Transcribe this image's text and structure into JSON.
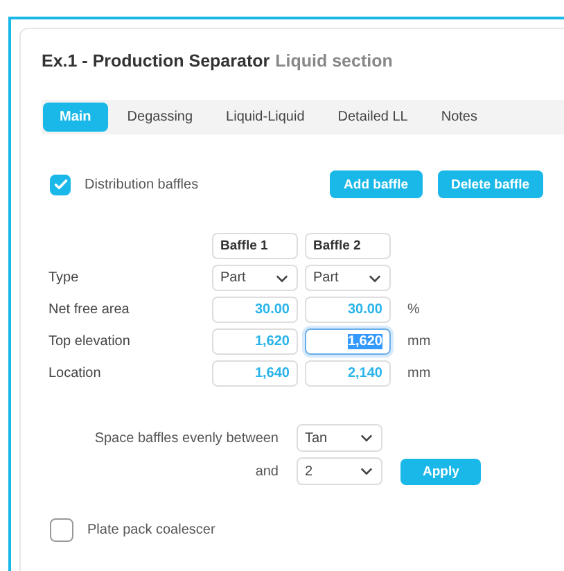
{
  "title": {
    "name": "Ex.1 - Production Separator",
    "section": "Liquid section"
  },
  "tabs": [
    {
      "label": "Main",
      "selected": true
    },
    {
      "label": "Degassing",
      "selected": false
    },
    {
      "label": "Liquid-Liquid",
      "selected": false
    },
    {
      "label": "Detailed LL",
      "selected": false
    },
    {
      "label": "Notes",
      "selected": false
    }
  ],
  "distribution_baffles": {
    "label": "Distribution baffles",
    "checked": true
  },
  "buttons": [
    "Add baffle",
    "Delete baffle"
  ],
  "baffles": {
    "columns": [
      "Baffle 1",
      "Baffle 2"
    ],
    "rows": [
      {
        "kind": "select",
        "label": "Type",
        "values": [
          {
            "value": "Part"
          },
          {
            "value": "Part"
          }
        ]
      },
      {
        "kind": "number",
        "label": "Net free area",
        "unit": "%",
        "values": [
          {
            "value": "30.00",
            "focused": false
          },
          {
            "value": "30.00",
            "focused": false
          }
        ]
      },
      {
        "kind": "number",
        "label": "Top elevation",
        "unit": "mm",
        "values": [
          {
            "value": "1,620",
            "focused": false
          },
          {
            "value": "1,620",
            "focused": true
          }
        ]
      },
      {
        "kind": "number",
        "label": "Location",
        "unit": "mm",
        "values": [
          {
            "value": "1,640",
            "focused": false
          },
          {
            "value": "2,140",
            "focused": false
          }
        ]
      }
    ]
  },
  "spacing": {
    "label": "Space baffles evenly between",
    "from": "Tan",
    "and_label": "and",
    "to": "2",
    "apply": "Apply"
  },
  "plate_pack": {
    "label": "Plate pack coalescer",
    "checked": false
  }
}
